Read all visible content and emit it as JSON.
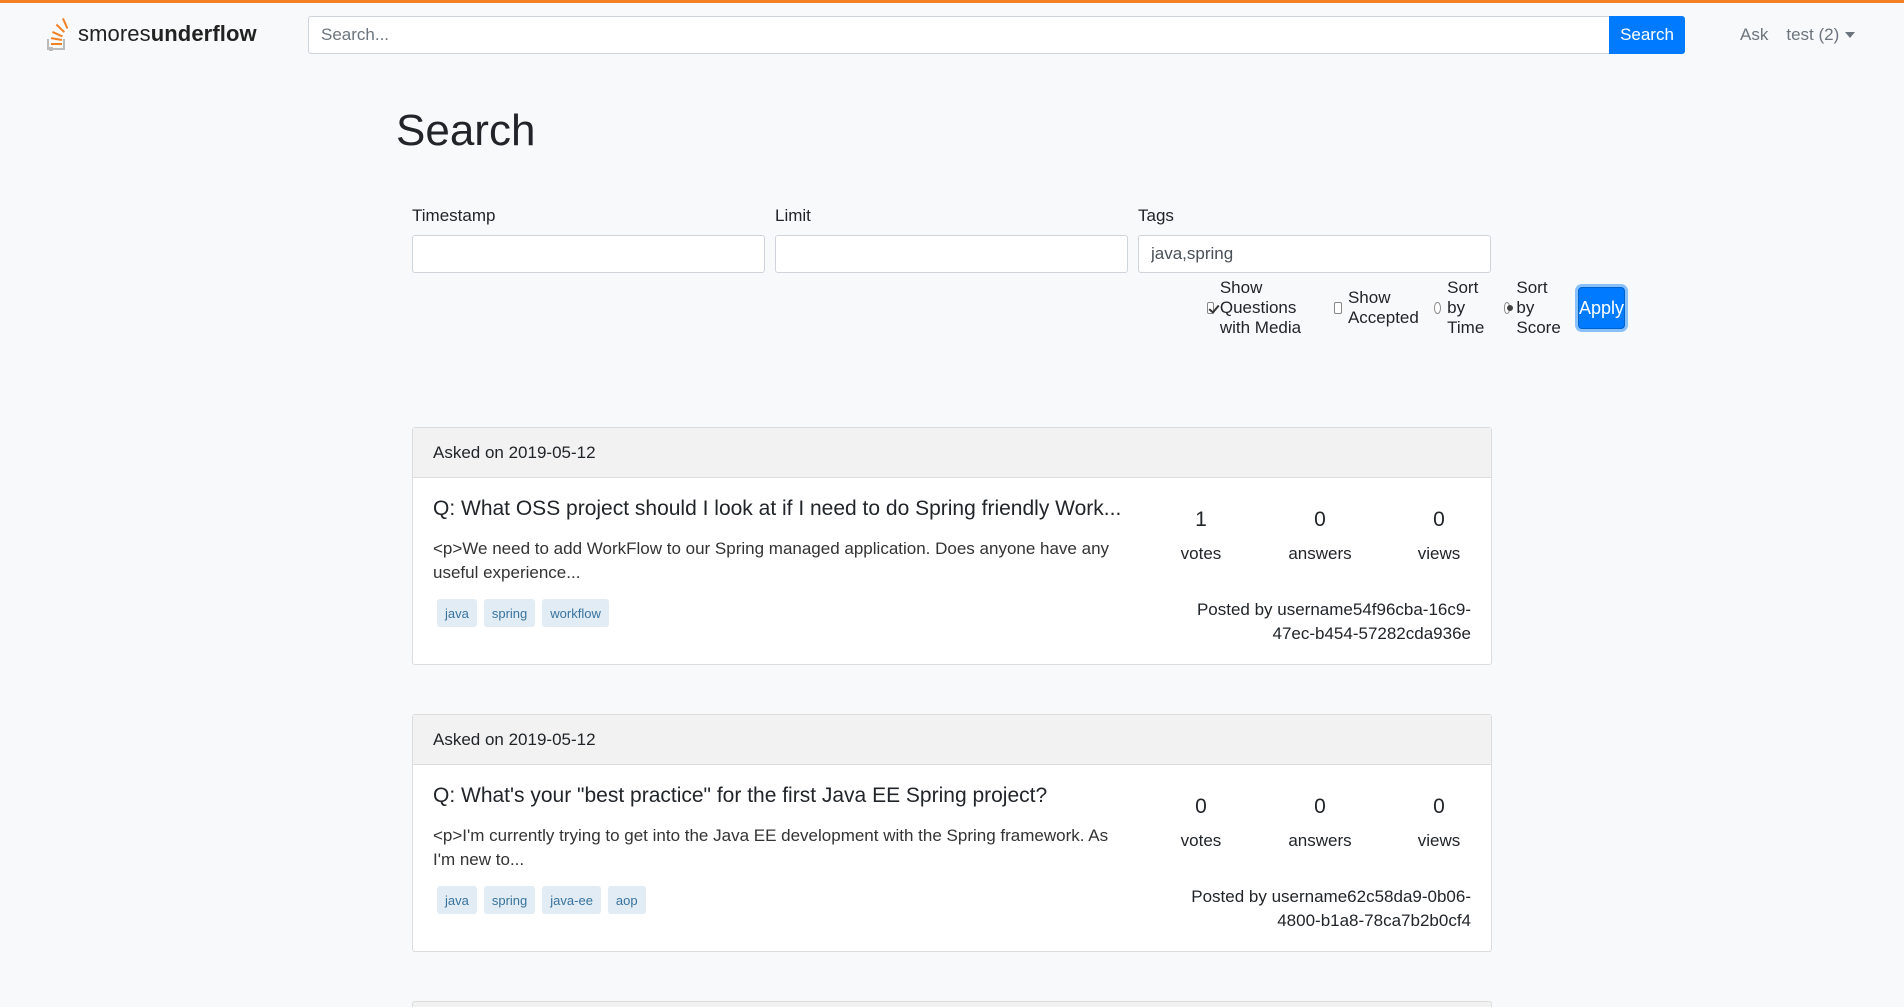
{
  "brand": {
    "name_plain": "smores",
    "name_bold": "underflow",
    "icon": "stack-logo-icon"
  },
  "search": {
    "placeholder": "Search...",
    "button_label": "Search"
  },
  "nav": {
    "ask_label": "Ask",
    "user_label": "test (2)"
  },
  "page": {
    "title": "Search"
  },
  "filters": {
    "timestamp_label": "Timestamp",
    "timestamp_value": "",
    "limit_label": "Limit",
    "limit_value": "",
    "tags_label": "Tags",
    "tags_value": "java,spring",
    "show_media_label": "Show Questions with Media",
    "show_media_checked": true,
    "show_accepted_label": "Show Accepted",
    "show_accepted_checked": false,
    "sort_time_label": "Sort by Time",
    "sort_score_label": "Sort by Score",
    "sort_selected": "score",
    "apply_label": "Apply"
  },
  "questions": [
    {
      "asked": "Asked on 2019-05-12",
      "title": "Q: What OSS project should I look at if I need to do Spring friendly Work...",
      "snippet": "<p>We need to add WorkFlow to our Spring managed application. Does anyone have any useful experience...",
      "tags": [
        "java",
        "spring",
        "workflow"
      ],
      "votes": "1",
      "votes_label": "votes",
      "answers": "0",
      "answers_label": "answers",
      "views": "0",
      "views_label": "views",
      "posted_by": "Posted by username54f96cba-16c9-47ec-b454-57282cda936e"
    },
    {
      "asked": "Asked on 2019-05-12",
      "title": "Q: What's your \"best practice\" for the first Java EE Spring project?",
      "snippet": "<p>I'm currently trying to get into the Java EE development with the Spring framework. As I'm new to...",
      "tags": [
        "java",
        "spring",
        "java-ee",
        "aop"
      ],
      "votes": "0",
      "votes_label": "votes",
      "answers": "0",
      "answers_label": "answers",
      "views": "0",
      "views_label": "views",
      "posted_by": "Posted by username62c58da9-0b06-4800-b1a8-78ca7b2b0cf4"
    }
  ],
  "colors": {
    "accent": "#007bff",
    "brand_orange": "#f48024",
    "tag_bg": "#e1ecf4",
    "tag_text": "#39739d"
  }
}
